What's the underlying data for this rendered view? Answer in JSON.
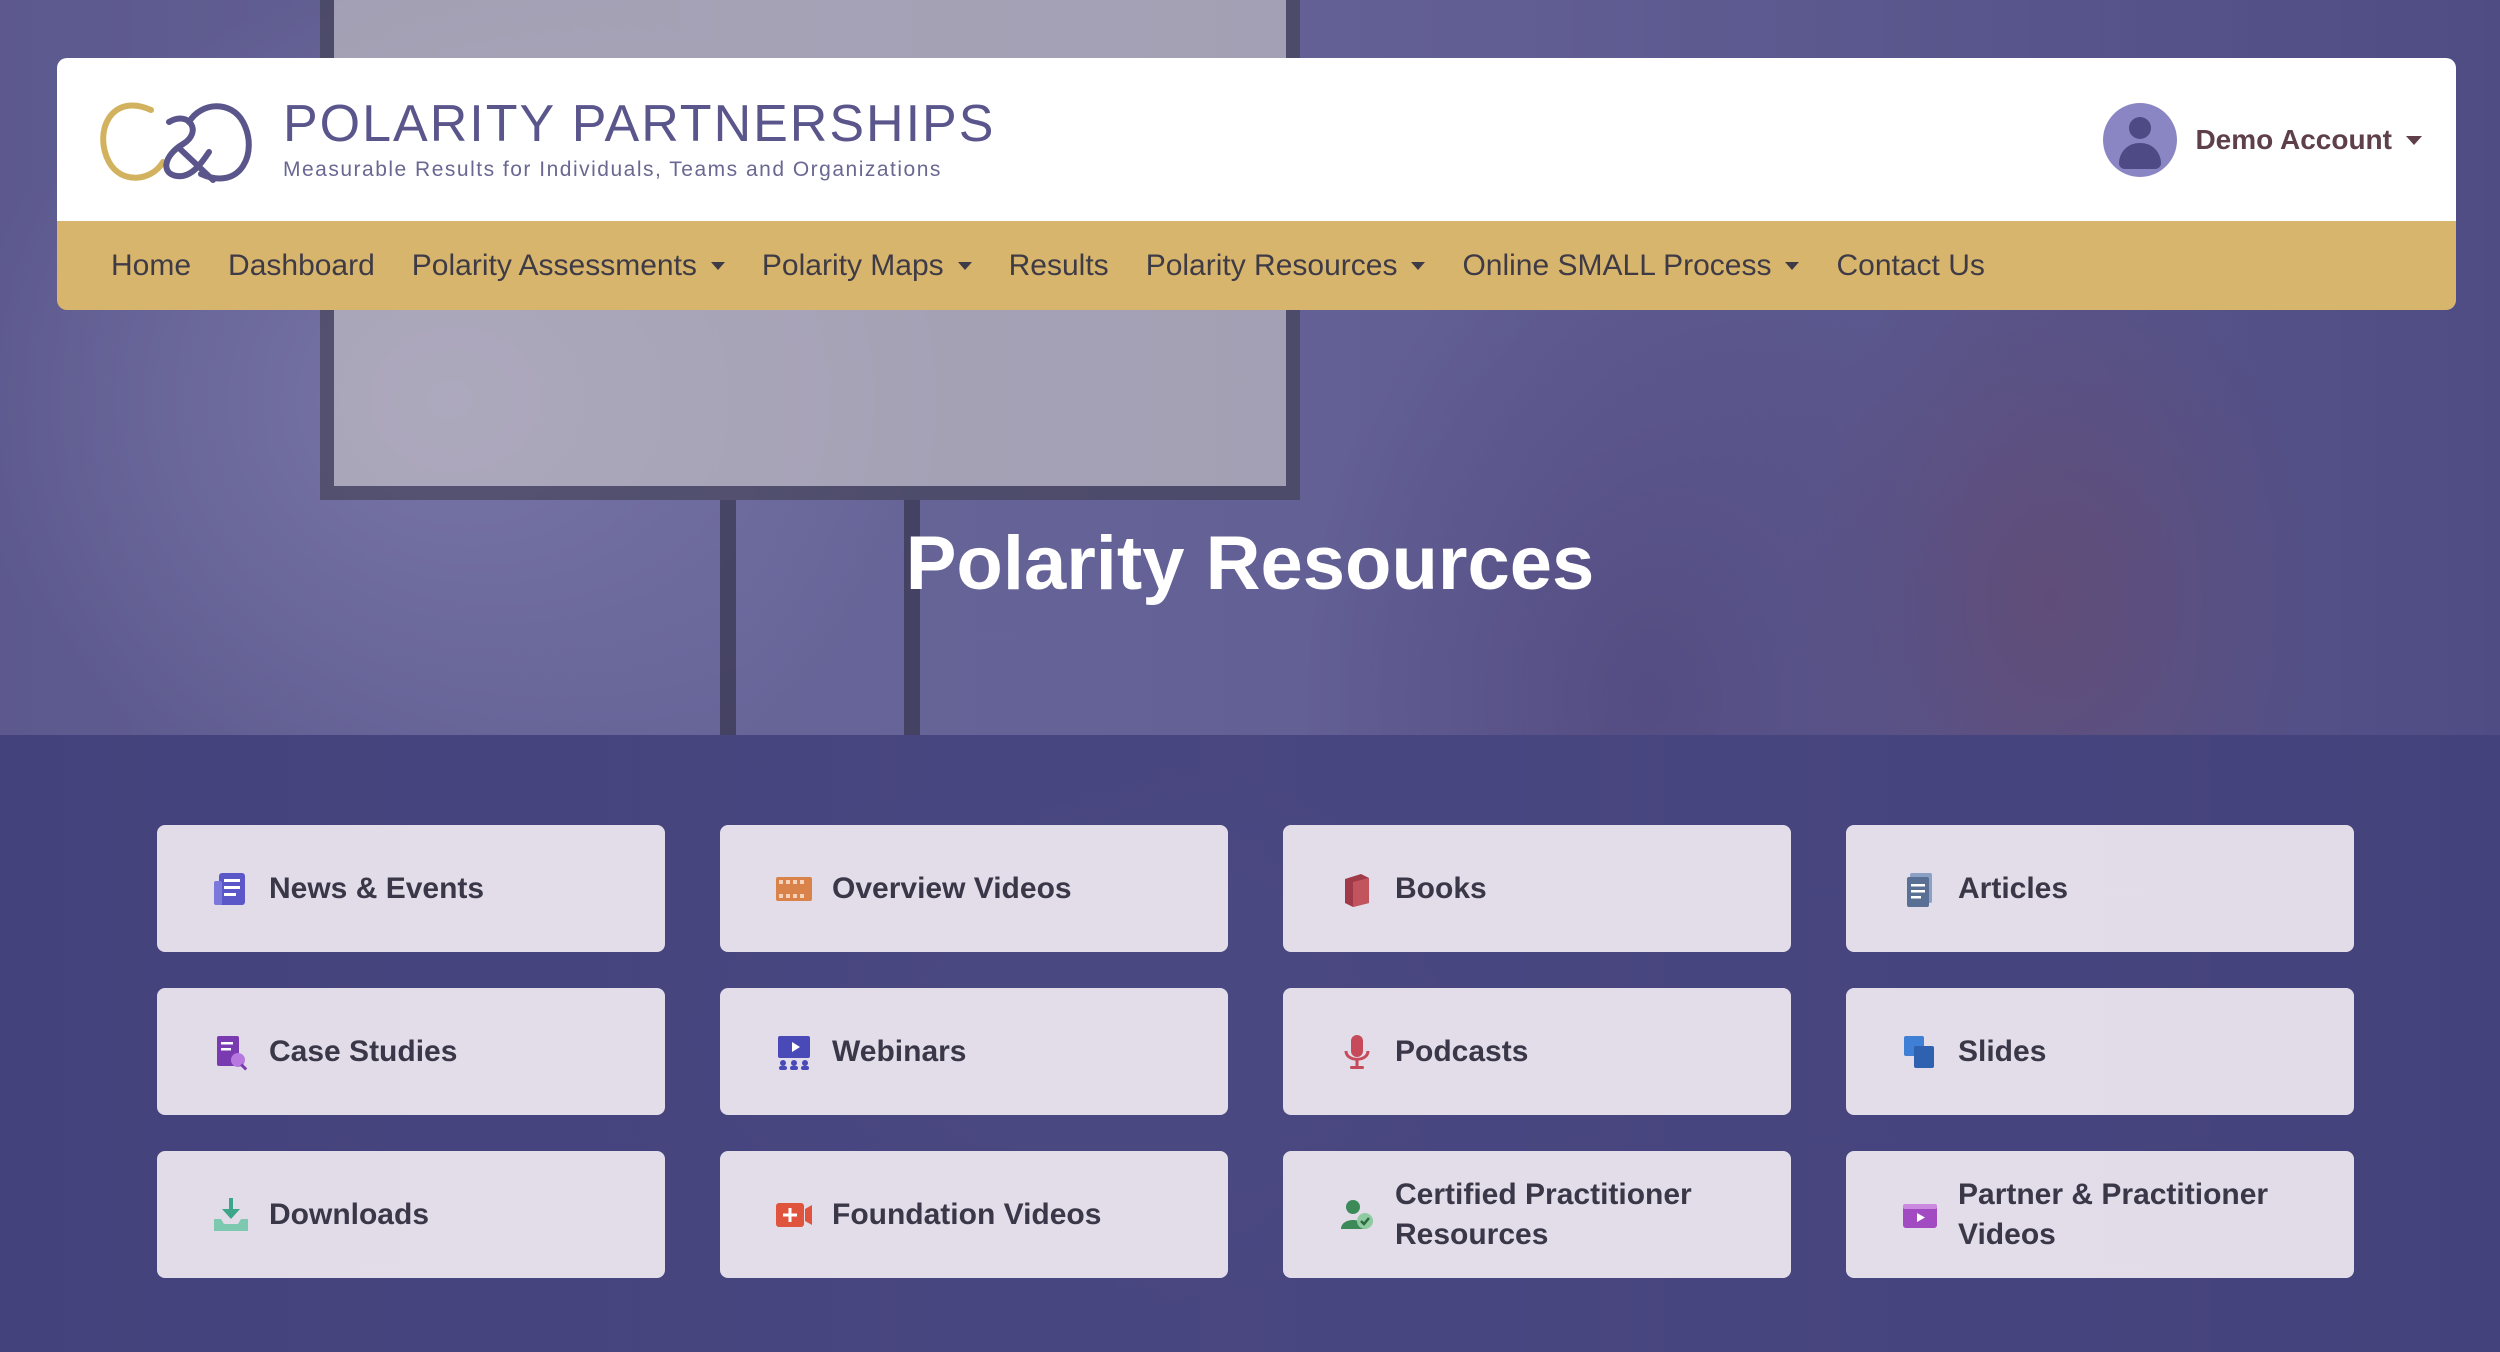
{
  "brand": {
    "name": "POLARITY PARTNERSHIPS",
    "tagline": "Measurable Results for Individuals, Teams and Organizations",
    "accent_gold": "#d8b56c",
    "accent_purple": "#5a568c"
  },
  "account": {
    "label": "Demo Account",
    "icon": "user-avatar-icon"
  },
  "nav": {
    "items": [
      {
        "label": "Home",
        "dropdown": false
      },
      {
        "label": "Dashboard",
        "dropdown": false
      },
      {
        "label": "Polarity Assessments",
        "dropdown": true
      },
      {
        "label": "Polarity Maps",
        "dropdown": true
      },
      {
        "label": "Results",
        "dropdown": false
      },
      {
        "label": "Polarity Resources",
        "dropdown": true
      },
      {
        "label": "Online SMALL Process",
        "dropdown": true
      },
      {
        "label": "Contact Us",
        "dropdown": false
      }
    ]
  },
  "hero": {
    "title": "Polarity Resources"
  },
  "resources": [
    {
      "label": "News & Events",
      "icon": "newspaper-icon",
      "color": "#5b57c8"
    },
    {
      "label": "Overview Videos",
      "icon": "film-icon",
      "color": "#d9824a"
    },
    {
      "label": "Books",
      "icon": "book-icon",
      "color": "#a13a48"
    },
    {
      "label": "Articles",
      "icon": "document-icon",
      "color": "#5a6f94"
    },
    {
      "label": "Case Studies",
      "icon": "case-study-icon",
      "color": "#7a3ab0"
    },
    {
      "label": "Webinars",
      "icon": "webinar-icon",
      "color": "#4a49b8"
    },
    {
      "label": "Podcasts",
      "icon": "microphone-icon",
      "color": "#c64a5a"
    },
    {
      "label": "Slides",
      "icon": "slides-icon",
      "color": "#3f7fd6"
    },
    {
      "label": "Downloads",
      "icon": "download-icon",
      "color": "#3ca58a"
    },
    {
      "label": "Foundation Videos",
      "icon": "video-add-icon",
      "color": "#e0543e"
    },
    {
      "label": "Certified Practitioner Resources",
      "icon": "practitioner-icon",
      "color": "#3c8a58"
    },
    {
      "label": "Partner & Practitioner Videos",
      "icon": "video-player-icon",
      "color": "#a14ac2"
    }
  ]
}
